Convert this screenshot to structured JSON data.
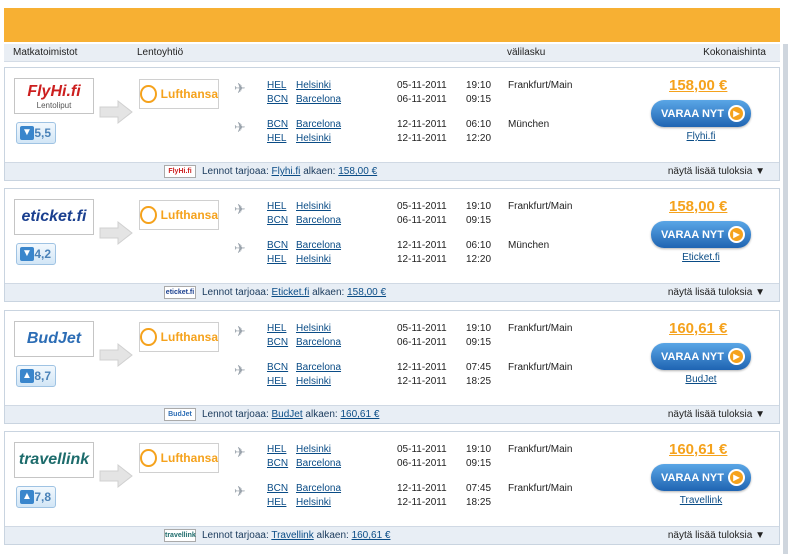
{
  "header": {
    "col_agency": "Matkatoimistot",
    "col_airline": "Lentoyhtiö",
    "col_stopover": "välilasku",
    "col_total": "Kokonaishinta"
  },
  "colors": {
    "accent": "#f7b033",
    "price": "#f5a21c",
    "button": "#1f64b2",
    "link": "#0a4c86"
  },
  "results": [
    {
      "agency": "FlyHi.fi",
      "agency_sub": "Lentoliput",
      "agency_color": "#cc1f1f",
      "rating": "5,5",
      "thumb": "down",
      "airline": "Lufthansa",
      "out": [
        {
          "code": "HEL",
          "city": "Helsinki",
          "date": "05-11-2011",
          "time": "19:10",
          "stop": "Frankfurt/Main"
        },
        {
          "code": "BCN",
          "city": "Barcelona",
          "date": "06-11-2011",
          "time": "09:15",
          "stop": ""
        }
      ],
      "ret": [
        {
          "code": "BCN",
          "city": "Barcelona",
          "date": "12-11-2011",
          "time": "06:10",
          "stop": "München"
        },
        {
          "code": "HEL",
          "city": "Helsinki",
          "date": "12-11-2011",
          "time": "12:20",
          "stop": ""
        }
      ],
      "price": "158,00 €",
      "book": "VARAA NYT",
      "link": "Flyhi.fi",
      "offer_prefix": "Lennot tarjoaa:",
      "offer_agency": "Flyhi.fi",
      "offer_from": "alkaen:",
      "offer_price": "158,00 €",
      "more": "näytä lisää tuloksia ▼"
    },
    {
      "agency": "eticket.fi",
      "agency_sub": "",
      "agency_color": "#1a3f8f",
      "rating": "4,2",
      "thumb": "down",
      "airline": "Lufthansa",
      "out": [
        {
          "code": "HEL",
          "city": "Helsinki",
          "date": "05-11-2011",
          "time": "19:10",
          "stop": "Frankfurt/Main"
        },
        {
          "code": "BCN",
          "city": "Barcelona",
          "date": "06-11-2011",
          "time": "09:15",
          "stop": ""
        }
      ],
      "ret": [
        {
          "code": "BCN",
          "city": "Barcelona",
          "date": "12-11-2011",
          "time": "06:10",
          "stop": "München"
        },
        {
          "code": "HEL",
          "city": "Helsinki",
          "date": "12-11-2011",
          "time": "12:20",
          "stop": ""
        }
      ],
      "price": "158,00 €",
      "book": "VARAA NYT",
      "link": "Eticket.fi",
      "offer_prefix": "Lennot tarjoaa:",
      "offer_agency": "Eticket.fi",
      "offer_from": "alkaen:",
      "offer_price": "158,00 €",
      "more": "näytä lisää tuloksia ▼"
    },
    {
      "agency": "BudJet",
      "agency_sub": "",
      "agency_color": "#2c6db5",
      "rating": "8,7",
      "thumb": "up",
      "airline": "Lufthansa",
      "out": [
        {
          "code": "HEL",
          "city": "Helsinki",
          "date": "05-11-2011",
          "time": "19:10",
          "stop": "Frankfurt/Main"
        },
        {
          "code": "BCN",
          "city": "Barcelona",
          "date": "06-11-2011",
          "time": "09:15",
          "stop": ""
        }
      ],
      "ret": [
        {
          "code": "BCN",
          "city": "Barcelona",
          "date": "12-11-2011",
          "time": "07:45",
          "stop": "Frankfurt/Main"
        },
        {
          "code": "HEL",
          "city": "Helsinki",
          "date": "12-11-2011",
          "time": "18:25",
          "stop": ""
        }
      ],
      "price": "160,61 €",
      "book": "VARAA NYT",
      "link": "BudJet",
      "offer_prefix": "Lennot tarjoaa:",
      "offer_agency": "BudJet",
      "offer_from": "alkaen:",
      "offer_price": "160,61 €",
      "more": "näytä lisää tuloksia ▼"
    },
    {
      "agency": "travellink",
      "agency_sub": "",
      "agency_color": "#1c6b6b",
      "rating": "7,8",
      "thumb": "up",
      "airline": "Lufthansa",
      "out": [
        {
          "code": "HEL",
          "city": "Helsinki",
          "date": "05-11-2011",
          "time": "19:10",
          "stop": "Frankfurt/Main"
        },
        {
          "code": "BCN",
          "city": "Barcelona",
          "date": "06-11-2011",
          "time": "09:15",
          "stop": ""
        }
      ],
      "ret": [
        {
          "code": "BCN",
          "city": "Barcelona",
          "date": "12-11-2011",
          "time": "07:45",
          "stop": "Frankfurt/Main"
        },
        {
          "code": "HEL",
          "city": "Helsinki",
          "date": "12-11-2011",
          "time": "18:25",
          "stop": ""
        }
      ],
      "price": "160,61 €",
      "book": "VARAA NYT",
      "link": "Travellink",
      "offer_prefix": "Lennot tarjoaa:",
      "offer_agency": "Travellink",
      "offer_from": "alkaen:",
      "offer_price": "160,61 €",
      "more": "näytä lisää tuloksia ▼"
    }
  ]
}
